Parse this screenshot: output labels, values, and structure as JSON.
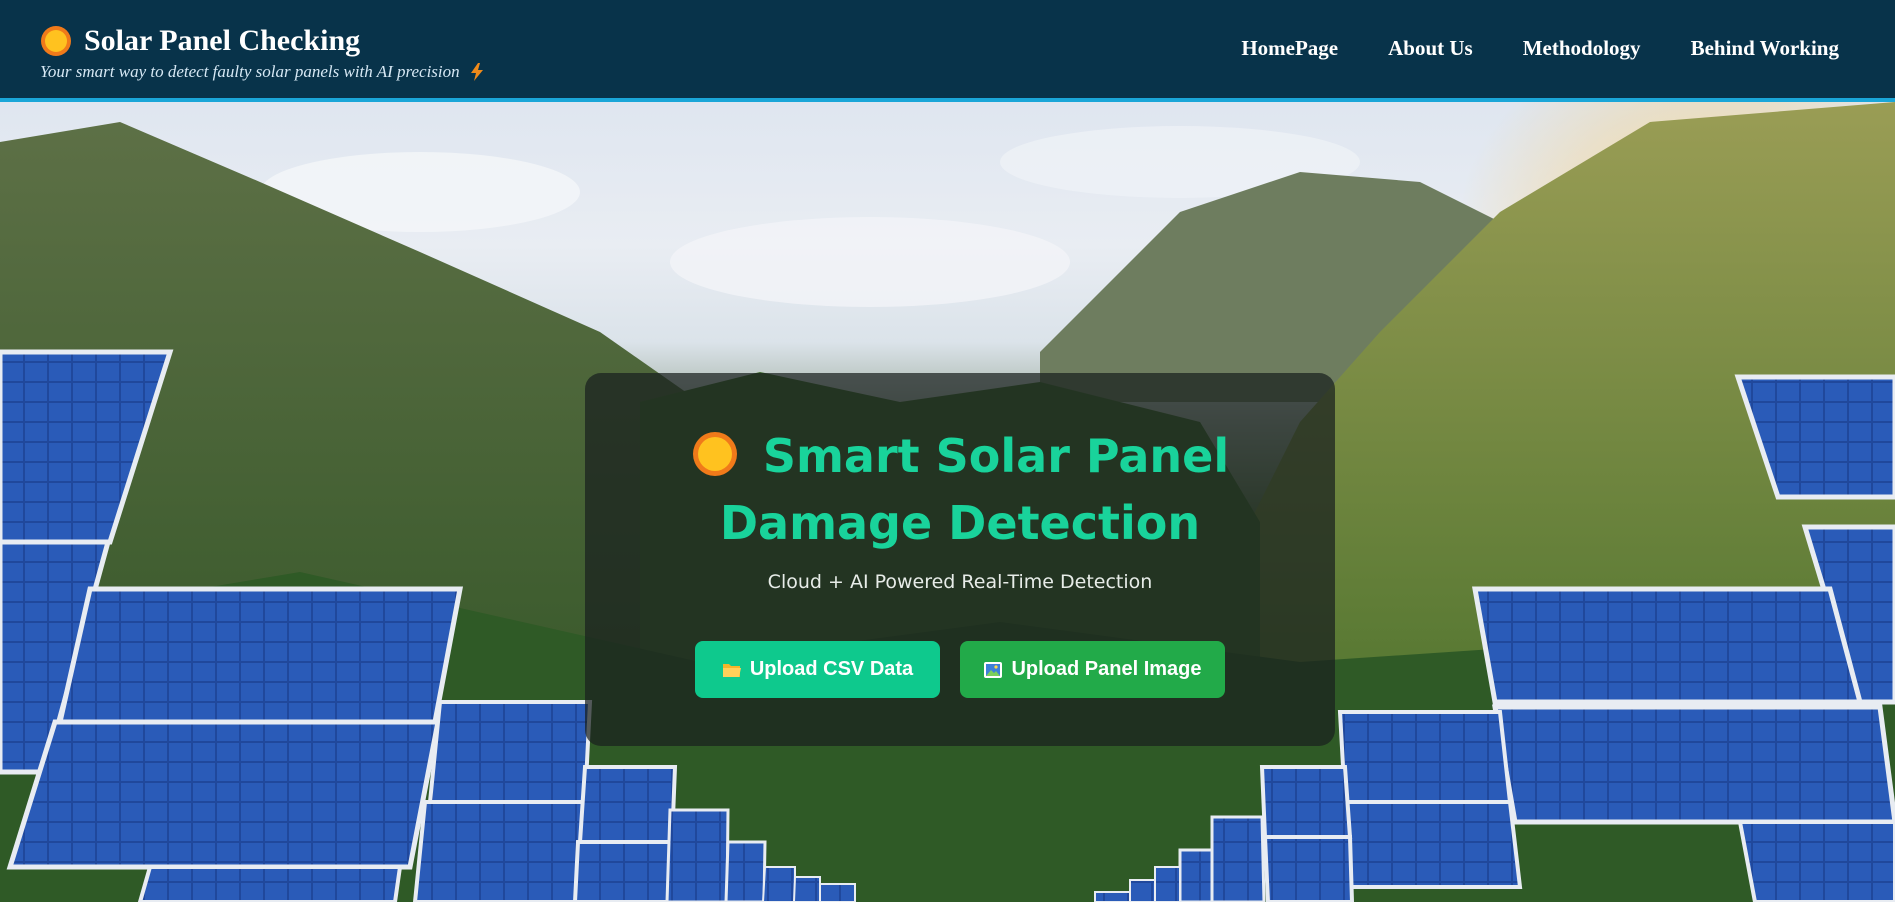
{
  "header": {
    "title": "Solar Panel Checking",
    "tagline": "Your smart way to detect faulty solar panels with AI precision",
    "nav": [
      {
        "label": "HomePage"
      },
      {
        "label": "About Us"
      },
      {
        "label": "Methodology"
      },
      {
        "label": "Behind Working"
      }
    ]
  },
  "hero": {
    "title_line1": "Smart Solar Panel",
    "title_line2": "Damage Detection",
    "subtitle": "Cloud + AI Powered Real-Time Detection",
    "buttons": {
      "csv_label": "Upload CSV Data",
      "image_label": "Upload Panel Image"
    }
  },
  "colors": {
    "header_bg": "#08334a",
    "header_border": "#1aa6d8",
    "accent_green": "#19d39b",
    "csv_button": "#0ec98d",
    "image_button": "#22aa49"
  },
  "icons": [
    "sun-icon",
    "lightning-icon",
    "folder-icon",
    "image-icon"
  ]
}
